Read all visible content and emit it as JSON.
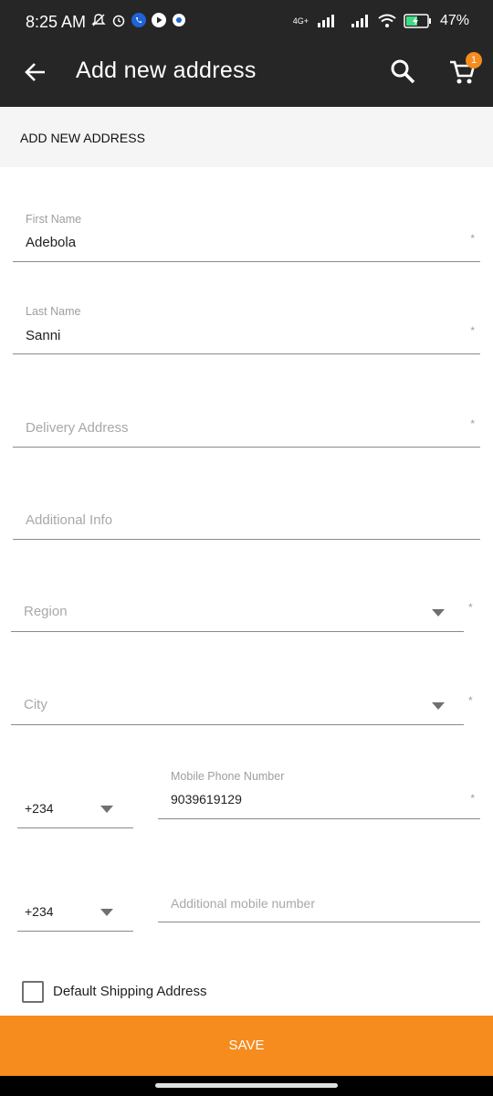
{
  "status_bar": {
    "time": "8:25 AM",
    "battery": "47%",
    "network": "4G+"
  },
  "app_bar": {
    "title": "Add new address",
    "cart_count": "1"
  },
  "section": {
    "title": "ADD NEW ADDRESS"
  },
  "form": {
    "first_name": {
      "label": "First Name",
      "value": "Adebola",
      "required": "*"
    },
    "last_name": {
      "label": "Last Name",
      "value": "Sanni",
      "required": "*"
    },
    "delivery_address": {
      "placeholder": "Delivery Address",
      "required": "*"
    },
    "additional_info": {
      "placeholder": "Additional Info"
    },
    "region": {
      "placeholder": "Region",
      "required": "*"
    },
    "city": {
      "placeholder": "City",
      "required": "*"
    },
    "phone_code_1": "+234",
    "mobile_phone": {
      "label": "Mobile Phone Number",
      "value": "9039619129",
      "required": "*"
    },
    "phone_code_2": "+234",
    "additional_mobile": {
      "placeholder": "Additional mobile number"
    },
    "default_shipping_label": "Default Shipping Address"
  },
  "actions": {
    "save_label": "SAVE"
  },
  "colors": {
    "accent": "#f68b1e",
    "appbar": "#262626"
  }
}
